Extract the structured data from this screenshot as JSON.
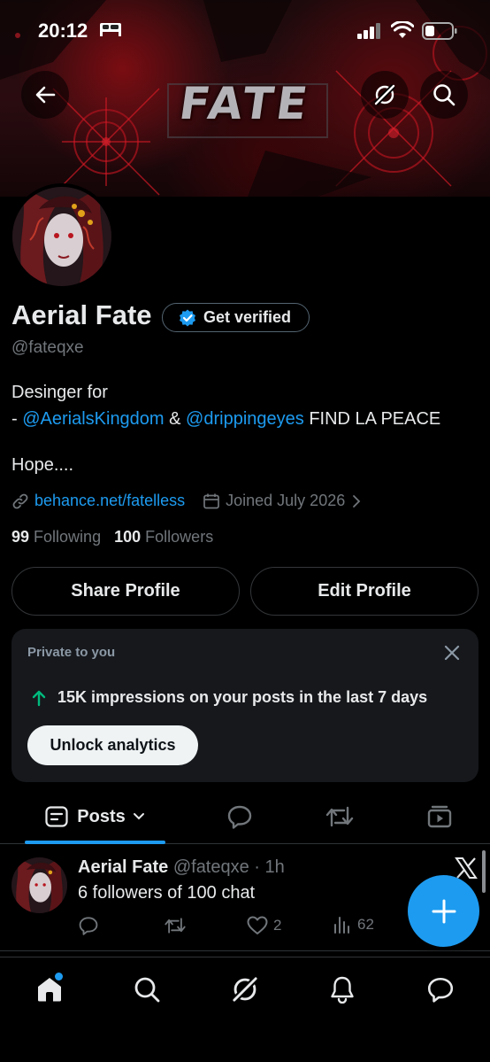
{
  "status_bar": {
    "time": "20:12"
  },
  "banner": {
    "title": "FATE"
  },
  "profile": {
    "name": "Aerial Fate",
    "verify_label": "Get verified",
    "handle": "@fateqxe",
    "bio": {
      "line1": "Desinger for",
      "dash": "- ",
      "mention1": "@AerialsKingdom",
      "amp": " & ",
      "mention2": "@drippingeyes",
      "tail": " FIND LA PEACE",
      "line3": "Hope...."
    },
    "website": "behance.net/fatelless",
    "joined": "Joined July 2026",
    "following_count": "99",
    "following_label": "Following",
    "followers_count": "100",
    "followers_label": "Followers"
  },
  "buttons": {
    "share": "Share Profile",
    "edit": "Edit Profile"
  },
  "analytics_card": {
    "label": "Private to you",
    "impressions": "15K impressions on your posts in the last 7 days",
    "unlock": "Unlock analytics"
  },
  "tabs": {
    "posts": "Posts"
  },
  "post": {
    "name": "Aerial Fate",
    "handle_time": "@fateqxe · 1h",
    "text": "6 followers of 100 chat",
    "likes": "2",
    "views": "62"
  },
  "colors": {
    "accent": "#1d9bf0",
    "background": "#000000",
    "muted": "#71767b",
    "text": "#e7e9ea"
  },
  "icons": {
    "back": "arrow-left-icon",
    "grok": "grok-icon",
    "search": "search-icon",
    "home": "home-icon",
    "notifications": "bell-icon",
    "messages": "chat-icon"
  }
}
